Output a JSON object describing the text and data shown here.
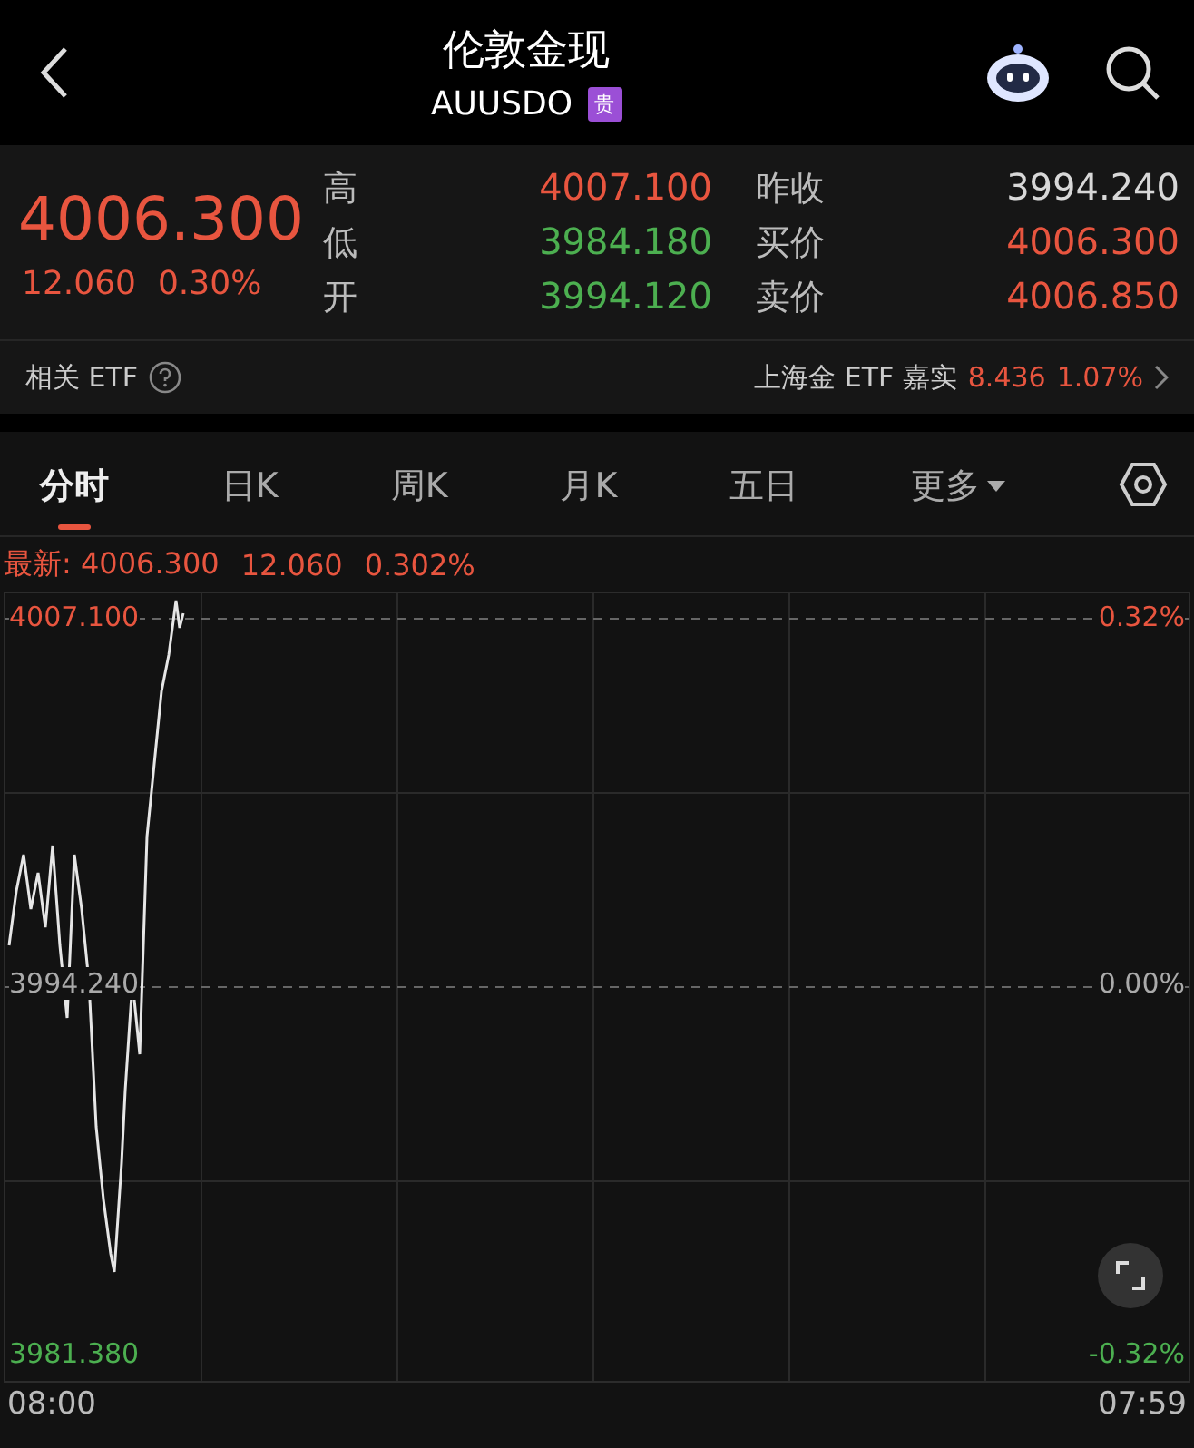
{
  "header": {
    "title": "伦敦金现",
    "code": "AUUSDO",
    "badge": "贵"
  },
  "quote": {
    "price": "4006.300",
    "change": "12.060",
    "percent": "0.30%",
    "stats": [
      {
        "label": "高",
        "value": "4007.100",
        "color": "#e8553f"
      },
      {
        "label": "低",
        "value": "3984.180",
        "color": "#4caf50"
      },
      {
        "label": "开",
        "value": "3994.120",
        "color": "#4caf50"
      }
    ],
    "stats_right": [
      {
        "label": "昨收",
        "value": "3994.240",
        "color": "#d8d8d8"
      },
      {
        "label": "买价",
        "value": "4006.300",
        "color": "#e8553f"
      },
      {
        "label": "卖价",
        "value": "4006.850",
        "color": "#e8553f"
      }
    ]
  },
  "etf": {
    "label": "相关 ETF",
    "name": "上海金 ETF 嘉实",
    "price": "8.436",
    "percent": "1.07%"
  },
  "tabs": [
    {
      "label": "分时",
      "selected": true
    },
    {
      "label": "日K",
      "selected": false
    },
    {
      "label": "周K",
      "selected": false
    },
    {
      "label": "月K",
      "selected": false
    },
    {
      "label": "五日",
      "selected": false
    },
    {
      "label": "更多",
      "selected": false,
      "kind": "dropdown"
    }
  ],
  "latest": {
    "label": "最新:",
    "price": "4006.300",
    "change": "12.060",
    "percent": "0.302%"
  },
  "chart": {
    "high": "4007.100",
    "high_pct": "0.32%",
    "mid": "3994.240",
    "mid_pct": "0.00%",
    "low": "3981.380",
    "low_pct": "-0.32%",
    "start": "08:00",
    "end": "07:59"
  }
}
